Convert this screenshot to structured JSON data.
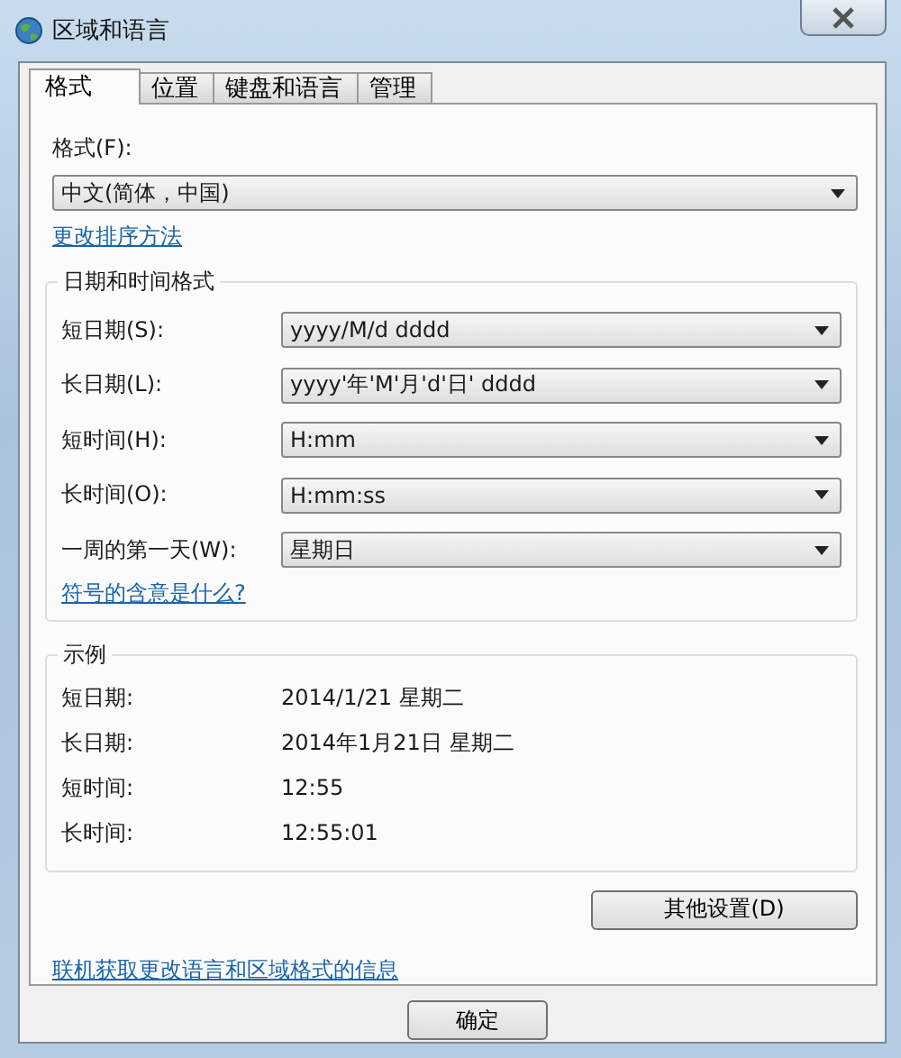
{
  "window": {
    "title": "区域和语言"
  },
  "tabs": [
    {
      "label": "格式",
      "selected": true
    },
    {
      "label": "位置",
      "selected": false
    },
    {
      "label": "键盘和语言",
      "selected": false
    },
    {
      "label": "管理",
      "selected": false
    }
  ],
  "format": {
    "label": "格式(F):",
    "value": "中文(简体，中国)"
  },
  "sort_link": "更改排序方法",
  "date_time_formats": {
    "title": "日期和时间格式",
    "rows": [
      {
        "label": "短日期(S):",
        "value": "yyyy/M/d dddd"
      },
      {
        "label": "长日期(L):",
        "value": "yyyy'年'M'月'd'日' dddd"
      },
      {
        "label": "短时间(H):",
        "value": "H:mm"
      },
      {
        "label": "长时间(O):",
        "value": "H:mm:ss"
      },
      {
        "label": "一周的第一天(W):",
        "value": "星期日"
      }
    ],
    "link": "符号的含意是什么?"
  },
  "examples": {
    "title": "示例",
    "rows": [
      {
        "label": "短日期:",
        "value": "2014/1/21 星期二"
      },
      {
        "label": "长日期:",
        "value": "2014年1月21日 星期二"
      },
      {
        "label": "短时间:",
        "value": "12:55"
      },
      {
        "label": "长时间:",
        "value": "12:55:01"
      }
    ]
  },
  "additional_settings_button": "其他设置(D)",
  "online_link": "联机获取更改语言和区域格式的信息",
  "buttons": [
    "确定"
  ]
}
